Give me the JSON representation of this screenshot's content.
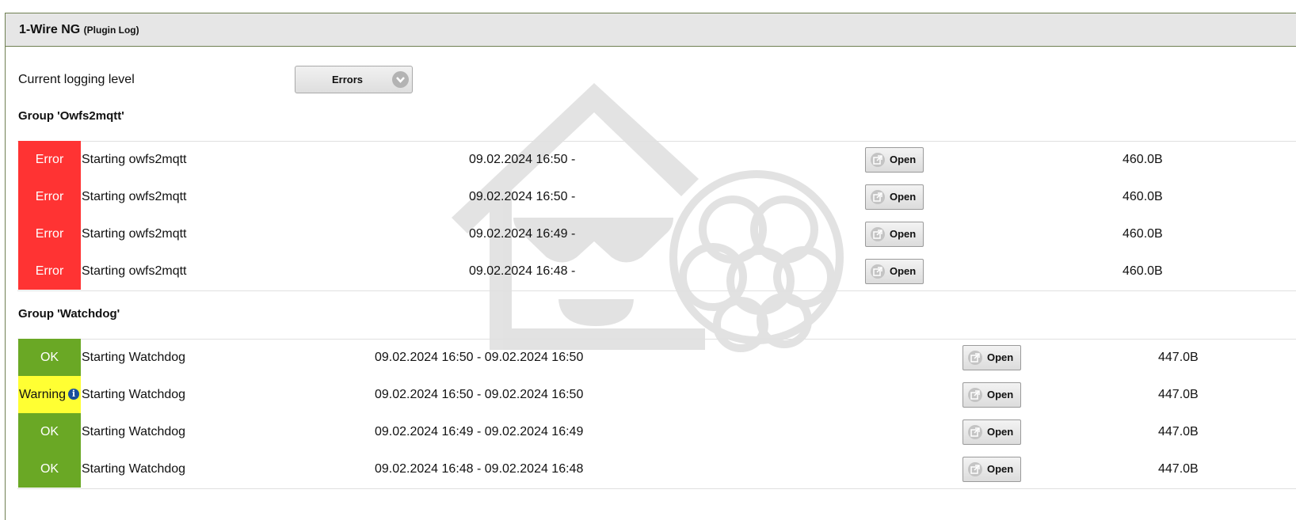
{
  "header": {
    "title": "1-Wire NG",
    "subtitle": "(Plugin Log)"
  },
  "logging": {
    "label": "Current logging level",
    "selected": "Errors"
  },
  "groups": [
    {
      "title": "Group 'Owfs2mqtt'",
      "rows": [
        {
          "status": "Error",
          "message": "Starting owfs2mqtt",
          "time": "09.02.2024 16:50 -",
          "open_label": "Open",
          "size": "460.0B"
        },
        {
          "status": "Error",
          "message": "Starting owfs2mqtt",
          "time": "09.02.2024 16:50 -",
          "open_label": "Open",
          "size": "460.0B"
        },
        {
          "status": "Error",
          "message": "Starting owfs2mqtt",
          "time": "09.02.2024 16:49 -",
          "open_label": "Open",
          "size": "460.0B"
        },
        {
          "status": "Error",
          "message": "Starting owfs2mqtt",
          "time": "09.02.2024 16:48 -",
          "open_label": "Open",
          "size": "460.0B"
        }
      ]
    },
    {
      "title": "Group 'Watchdog'",
      "rows": [
        {
          "status": "OK",
          "message": "Starting Watchdog",
          "time": "09.02.2024 16:50 - 09.02.2024 16:50",
          "open_label": "Open",
          "size": "447.0B"
        },
        {
          "status": "Warning",
          "message": "Starting Watchdog",
          "time": "09.02.2024 16:50 - 09.02.2024 16:50",
          "open_label": "Open",
          "size": "447.0B"
        },
        {
          "status": "OK",
          "message": "Starting Watchdog",
          "time": "09.02.2024 16:49 - 09.02.2024 16:49",
          "open_label": "Open",
          "size": "447.0B"
        },
        {
          "status": "OK",
          "message": "Starting Watchdog",
          "time": "09.02.2024 16:48 - 09.02.2024 16:48",
          "open_label": "Open",
          "size": "447.0B"
        }
      ]
    }
  ],
  "colors": {
    "error": "#ff3333",
    "ok": "#6aa825",
    "warning": "#ffff33",
    "info": "#1a4f9c"
  }
}
